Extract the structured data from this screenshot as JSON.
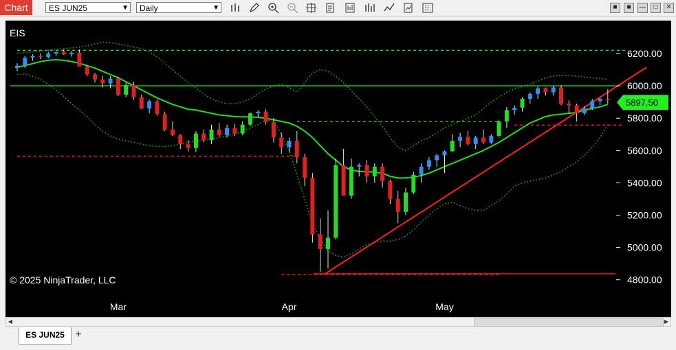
{
  "toolbar": {
    "chart_label": "Chart",
    "instrument": "ES JUN25",
    "interval": "Daily",
    "tools": [
      "bar-type-icon",
      "pencil-icon",
      "zoom-in-icon",
      "zoom-out-icon",
      "crosshair-icon",
      "properties-icon",
      "data-box-icon",
      "strategy-icon",
      "indicators-icon",
      "templates-icon",
      "screenshot-icon"
    ],
    "window_buttons": [
      "■",
      "■",
      "—",
      "□",
      "✕"
    ]
  },
  "chart": {
    "instrument_label": "EIS",
    "copyright": "© 2025 NinjaTrader, LLC",
    "price_marker": "5897.50",
    "colors": {
      "background": "#000000",
      "up": "#2f8ef5",
      "down": "#e02020",
      "strong_up": "#22dd22",
      "ma": "#22dd22",
      "trend": "#ff2020",
      "price_marker": "#22ee22"
    }
  },
  "tabs": {
    "active": "ES JUN25",
    "add": "+"
  },
  "chart_data": {
    "type": "candlestick",
    "y_ticks": [
      "6200.00",
      "6000.00",
      "5800.00",
      "5600.00",
      "5400.00",
      "5200.00",
      "5000.00",
      "4800.00"
    ],
    "ylim": [
      4750,
      6290
    ],
    "x_labels": [
      {
        "label": "Mar",
        "index": 13
      },
      {
        "label": "Apr",
        "index": 35
      },
      {
        "label": "May",
        "index": 55
      }
    ],
    "candles": [
      [
        6110,
        6140,
        6090,
        6125
      ],
      [
        6125,
        6185,
        6110,
        6175
      ],
      [
        6175,
        6195,
        6155,
        6185
      ],
      [
        6185,
        6200,
        6165,
        6178
      ],
      [
        6178,
        6210,
        6170,
        6200
      ],
      [
        6200,
        6215,
        6185,
        6210
      ],
      [
        6210,
        6225,
        6190,
        6195
      ],
      [
        6195,
        6215,
        6180,
        6205
      ],
      [
        6205,
        6225,
        6165,
        6120
      ],
      [
        6120,
        6130,
        6060,
        6070
      ],
      [
        6070,
        6080,
        6020,
        6040
      ],
      [
        6040,
        6060,
        5990,
        6015
      ],
      [
        6015,
        6060,
        5985,
        6045
      ],
      [
        6045,
        6055,
        5935,
        5945
      ],
      [
        5945,
        6020,
        5930,
        6005
      ],
      [
        6005,
        6025,
        5915,
        5930
      ],
      [
        5930,
        5945,
        5855,
        5860
      ],
      [
        5860,
        5915,
        5830,
        5905
      ],
      [
        5905,
        5915,
        5815,
        5825
      ],
      [
        5825,
        5840,
        5720,
        5730
      ],
      [
        5730,
        5780,
        5690,
        5695
      ],
      [
        5695,
        5700,
        5610,
        5640
      ],
      [
        5640,
        5665,
        5595,
        5615
      ],
      [
        5615,
        5720,
        5590,
        5705
      ],
      [
        5705,
        5730,
        5650,
        5665
      ],
      [
        5665,
        5760,
        5640,
        5730
      ],
      [
        5730,
        5770,
        5685,
        5695
      ],
      [
        5695,
        5760,
        5680,
        5740
      ],
      [
        5740,
        5765,
        5690,
        5705
      ],
      [
        5705,
        5780,
        5695,
        5760
      ],
      [
        5760,
        5835,
        5750,
        5830
      ],
      [
        5830,
        5850,
        5805,
        5840
      ],
      [
        5840,
        5855,
        5760,
        5775
      ],
      [
        5775,
        5800,
        5650,
        5680
      ],
      [
        5680,
        5710,
        5580,
        5620
      ],
      [
        5620,
        5680,
        5590,
        5660
      ],
      [
        5660,
        5720,
        5520,
        5560
      ],
      [
        5560,
        5580,
        5380,
        5430
      ],
      [
        5430,
        5460,
        5030,
        5080
      ],
      [
        5080,
        5180,
        4850,
        4990
      ],
      [
        4990,
        5230,
        4870,
        5060
      ],
      [
        5060,
        5550,
        5050,
        5510
      ],
      [
        5510,
        5610,
        5320,
        5320
      ],
      [
        5320,
        5550,
        5300,
        5500
      ],
      [
        5500,
        5520,
        5440,
        5510
      ],
      [
        5510,
        5540,
        5400,
        5440
      ],
      [
        5440,
        5520,
        5400,
        5500
      ],
      [
        5500,
        5520,
        5370,
        5410
      ],
      [
        5410,
        5420,
        5270,
        5300
      ],
      [
        5300,
        5350,
        5150,
        5220
      ],
      [
        5220,
        5370,
        5200,
        5340
      ],
      [
        5340,
        5470,
        5330,
        5450
      ],
      [
        5450,
        5520,
        5400,
        5500
      ],
      [
        5500,
        5560,
        5480,
        5540
      ],
      [
        5540,
        5580,
        5500,
        5570
      ],
      [
        5570,
        5600,
        5460,
        5595
      ],
      [
        5595,
        5700,
        5590,
        5660
      ],
      [
        5660,
        5710,
        5620,
        5685
      ],
      [
        5685,
        5720,
        5630,
        5640
      ],
      [
        5640,
        5690,
        5610,
        5680
      ],
      [
        5680,
        5730,
        5640,
        5650
      ],
      [
        5650,
        5700,
        5640,
        5690
      ],
      [
        5690,
        5790,
        5680,
        5780
      ],
      [
        5780,
        5870,
        5740,
        5850
      ],
      [
        5850,
        5880,
        5820,
        5865
      ],
      [
        5865,
        5930,
        5840,
        5920
      ],
      [
        5920,
        5960,
        5890,
        5950
      ],
      [
        5950,
        5995,
        5920,
        5985
      ],
      [
        5985,
        5990,
        5940,
        5960
      ],
      [
        5960,
        6000,
        5940,
        5990
      ],
      [
        5990,
        6005,
        5880,
        5890
      ],
      [
        5890,
        5910,
        5830,
        5880
      ],
      [
        5880,
        5890,
        5780,
        5830
      ],
      [
        5830,
        5875,
        5820,
        5860
      ],
      [
        5860,
        5920,
        5850,
        5905
      ],
      [
        5905,
        5930,
        5880,
        5920
      ],
      [
        5920,
        5980,
        5890,
        5915
      ]
    ],
    "moving_average": [
      6115,
      6125,
      6138,
      6150,
      6158,
      6162,
      6158,
      6150,
      6140,
      6125,
      6110,
      6090,
      6070,
      6050,
      6025,
      6000,
      5975,
      5950,
      5925,
      5905,
      5885,
      5870,
      5855,
      5850,
      5840,
      5830,
      5820,
      5815,
      5810,
      5808,
      5808,
      5805,
      5800,
      5790,
      5780,
      5770,
      5750,
      5720,
      5680,
      5630,
      5580,
      5540,
      5500,
      5480,
      5470,
      5470,
      5465,
      5460,
      5440,
      5430,
      5430,
      5435,
      5445,
      5460,
      5480,
      5500,
      5520,
      5540,
      5560,
      5580,
      5600,
      5625,
      5650,
      5680,
      5710,
      5740,
      5770,
      5790,
      5810,
      5820,
      5825,
      5830,
      5835,
      5850,
      5860,
      5870,
      5885
    ],
    "upper_band": [
      6200,
      6205,
      6210,
      6215,
      6220,
      6225,
      6230,
      6235,
      6240,
      6248,
      6260,
      6270,
      6268,
      6260,
      6250,
      6240,
      6230,
      6210,
      6180,
      6140,
      6100,
      6060,
      6020,
      5985,
      5950,
      5920,
      5900,
      5890,
      5890,
      5900,
      5920,
      5950,
      5980,
      6000,
      6010,
      5990,
      5960,
      6020,
      6080,
      6100,
      6090,
      6060,
      6020,
      5970,
      5920,
      5870,
      5810,
      5750,
      5680,
      5620,
      5600,
      5630,
      5660,
      5680,
      5710,
      5740,
      5760,
      5780,
      5800,
      5820,
      5860,
      5900,
      5930,
      5960,
      5980,
      5995,
      6010,
      6030,
      6050,
      6060,
      6065,
      6065,
      6060,
      6055,
      6050,
      6045,
      6040
    ],
    "lower_band": [
      6070,
      6075,
      6060,
      6040,
      6010,
      5975,
      5935,
      5890,
      5850,
      5810,
      5760,
      5720,
      5690,
      5670,
      5660,
      5650,
      5640,
      5630,
      5625,
      5625,
      5630,
      5640,
      5650,
      5660,
      5665,
      5670,
      5680,
      5690,
      5700,
      5720,
      5740,
      5760,
      5790,
      5780,
      5700,
      5600,
      5450,
      5300,
      5150,
      5050,
      4980,
      4950,
      4940,
      4960,
      4990,
      5020,
      5030,
      5040,
      5040,
      5050,
      5070,
      5110,
      5160,
      5200,
      5240,
      5270,
      5280,
      5260,
      5240,
      5230,
      5230,
      5260,
      5290,
      5330,
      5380,
      5400,
      5410,
      5420,
      5430,
      5450,
      5470,
      5500,
      5530,
      5570,
      5620,
      5680,
      5760
    ],
    "horizontal_lines": [
      {
        "price": 6000,
        "color": "#22dd22",
        "style": "solid"
      },
      {
        "price": 6220,
        "color": "#22dd22",
        "style": "dashed"
      },
      {
        "price": 5780,
        "color": "#22dd22",
        "style": "dashed"
      },
      {
        "price": 5565,
        "color": "#ff2020",
        "style": "dashed"
      },
      {
        "price": 5757,
        "color": "#ff2020",
        "style": "dashed"
      },
      {
        "price": 4833,
        "color": "#ff2020",
        "style": "dashed"
      },
      {
        "price": 4837,
        "color": "#ff2020",
        "style": "solid"
      }
    ],
    "trend_line": {
      "from": {
        "index": 39.5,
        "price": 4833
      },
      "to": {
        "index": 81,
        "price": 6115
      }
    }
  }
}
